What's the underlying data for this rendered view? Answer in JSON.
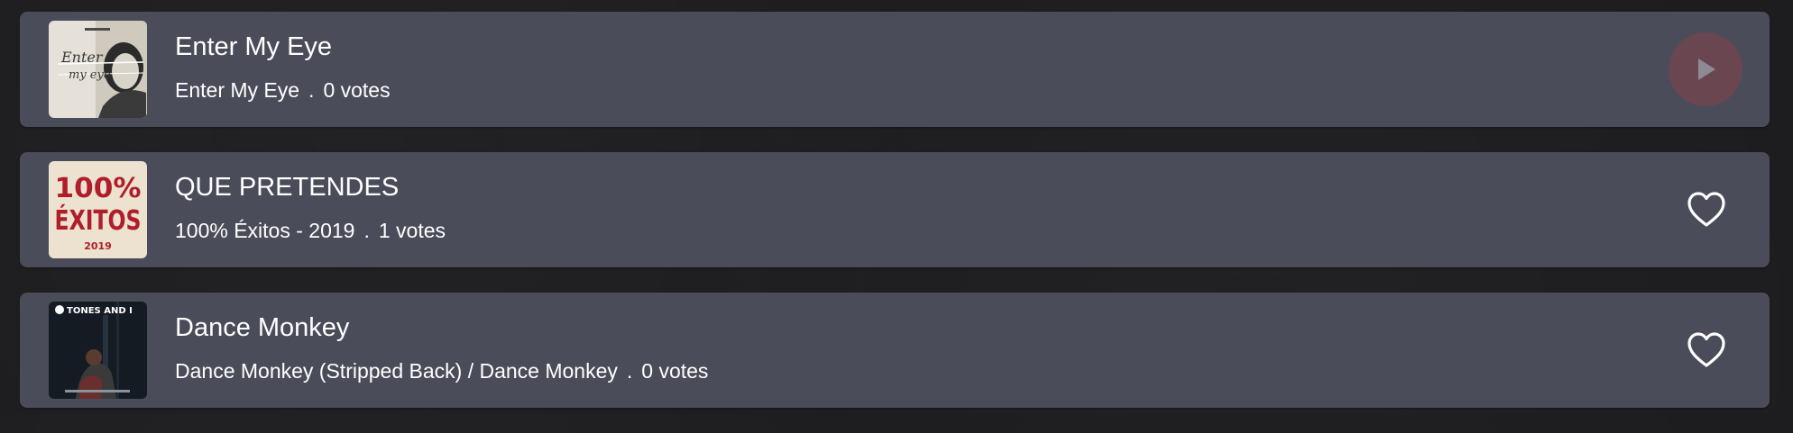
{
  "tracks": [
    {
      "title": "Enter My Eye",
      "album": "Enter My Eye",
      "votes": "0 votes",
      "separator": ".",
      "action": "play",
      "action_icon": "play-icon",
      "cover_icon": "album-cover-enter-my-eye",
      "cover_text": [
        "Enter",
        "my eye"
      ]
    },
    {
      "title": "QUE PRETENDES",
      "album": "100% Éxitos - 2019",
      "votes": "1 votes",
      "separator": ".",
      "action": "like",
      "action_icon": "heart-outline-icon",
      "cover_icon": "album-cover-100-exitos",
      "cover_text": [
        "100%",
        "ÉXITOS",
        "2019"
      ]
    },
    {
      "title": "Dance Monkey",
      "album": "Dance Monkey (Stripped Back) / Dance Monkey",
      "votes": "0 votes",
      "separator": ".",
      "action": "like",
      "action_icon": "heart-outline-icon",
      "cover_icon": "album-cover-dance-monkey",
      "cover_text": [
        "TONES AND I"
      ]
    }
  ],
  "colors": {
    "background": "#1d1d1f",
    "row": "#4a4c5a",
    "play_button": "#6a4650",
    "text": "#ffffff"
  }
}
